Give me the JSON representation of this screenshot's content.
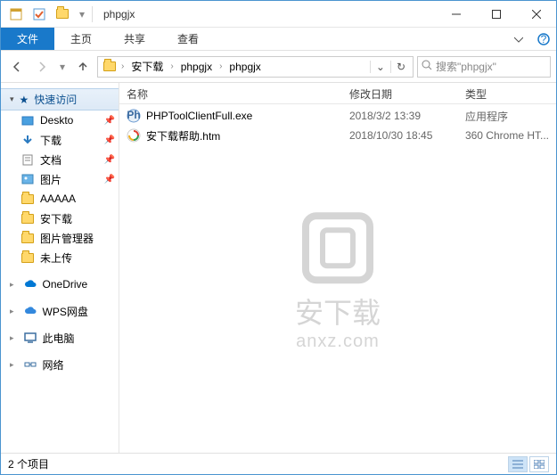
{
  "title": "phpgjx",
  "tabs": {
    "file": "文件",
    "home": "主页",
    "share": "共享",
    "view": "查看"
  },
  "breadcrumb": [
    "安下载",
    "phpgjx",
    "phpgjx"
  ],
  "search_placeholder": "搜索\"phpgjx\"",
  "columns": {
    "name": "名称",
    "date": "修改日期",
    "type": "类型"
  },
  "sidebar": {
    "quick": {
      "label": "快速访问",
      "items": [
        {
          "label": "Deskto",
          "pin": true
        },
        {
          "label": "下载",
          "pin": true
        },
        {
          "label": "文档",
          "pin": true
        },
        {
          "label": "图片",
          "pin": true
        },
        {
          "label": "AAAAA",
          "pin": false
        },
        {
          "label": "安下载",
          "pin": false
        },
        {
          "label": "图片管理器",
          "pin": false
        },
        {
          "label": "未上传",
          "pin": false
        }
      ]
    },
    "roots": [
      {
        "label": "OneDrive",
        "color": "#0078d4",
        "icon": "cloud"
      },
      {
        "label": "WPS网盘",
        "color": "#3388dd",
        "icon": "cloud"
      },
      {
        "label": "此电脑",
        "color": "#3b6fa0",
        "icon": "pc"
      },
      {
        "label": "网络",
        "color": "#3b6fa0",
        "icon": "net"
      }
    ]
  },
  "files": [
    {
      "name": "PHPToolClientFull.exe",
      "date": "2018/3/2 13:39",
      "type": "应用程序",
      "icon": "exe"
    },
    {
      "name": "安下载帮助.htm",
      "date": "2018/10/30 18:45",
      "type": "360 Chrome HT...",
      "icon": "htm"
    }
  ],
  "status": "2 个项目",
  "watermark": {
    "line1": "安下载",
    "line2": "anxz.com"
  }
}
